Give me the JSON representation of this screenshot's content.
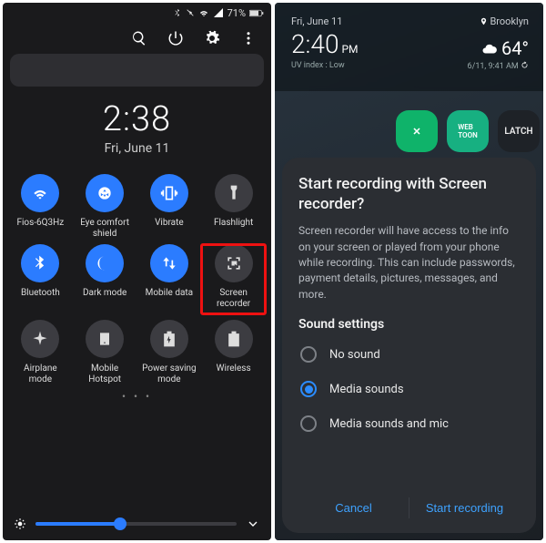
{
  "left": {
    "status": {
      "battery": "71%"
    },
    "clock": {
      "time": "2:38",
      "date": "Fri, June 11"
    },
    "tiles": [
      {
        "label": "Fios-6Q3Hz",
        "icon": "wifi",
        "on": true
      },
      {
        "label": "Eye comfort shield",
        "icon": "eye-comfort",
        "on": true
      },
      {
        "label": "Vibrate",
        "icon": "vibrate",
        "on": true
      },
      {
        "label": "Flashlight",
        "icon": "flashlight",
        "on": false
      },
      {
        "label": "Bluetooth",
        "icon": "bluetooth",
        "on": true
      },
      {
        "label": "Dark mode",
        "icon": "dark-mode",
        "on": true
      },
      {
        "label": "Mobile data",
        "icon": "mobile-data",
        "on": true
      },
      {
        "label": "Screen recorder",
        "icon": "screen-recorder",
        "on": false,
        "highlight": true
      },
      {
        "label": "Airplane mode",
        "icon": "airplane",
        "on": false
      },
      {
        "label": "Mobile Hotspot",
        "icon": "hotspot",
        "on": false
      },
      {
        "label": "Power saving mode",
        "icon": "power-saving",
        "on": false
      },
      {
        "label": "Wireless",
        "icon": "wireless",
        "on": false
      }
    ],
    "brightness_pct": 42
  },
  "right": {
    "status": {
      "date": "Fri, June 11",
      "location": "Brooklyn",
      "time": "2:40",
      "ampm": "PM",
      "temp": "64°",
      "uv": "UV index : Low",
      "updated": "6/11, 9:41 AM"
    },
    "dialog": {
      "title": "Start recording with Screen recorder?",
      "body": "Screen recorder will have access to the info on your screen or played from your phone while recording. This can include passwords, payment details, pictures, messages, and more.",
      "sound_heading": "Sound settings",
      "options": [
        {
          "label": "No sound",
          "checked": false
        },
        {
          "label": "Media sounds",
          "checked": true
        },
        {
          "label": "Media sounds and mic",
          "checked": false
        }
      ],
      "cancel": "Cancel",
      "confirm": "Start recording"
    }
  }
}
